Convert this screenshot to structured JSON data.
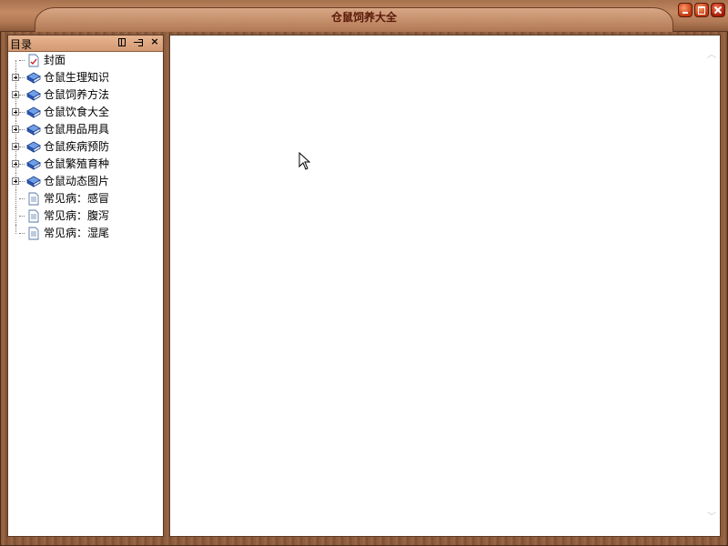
{
  "window": {
    "title": "仓鼠饲养大全",
    "buttons": {
      "minimize": "minimize-icon",
      "maximize": "maximize-icon",
      "close": "close-icon"
    }
  },
  "sidebar": {
    "title": "目录",
    "header_icons": [
      "split-view-icon",
      "pin-icon",
      "close-icon"
    ],
    "items": [
      {
        "label": "封面",
        "icon": "document-check-icon",
        "expandable": false
      },
      {
        "label": "仓鼠生理知识",
        "icon": "book-icon",
        "expandable": true
      },
      {
        "label": "仓鼠饲养方法",
        "icon": "book-icon",
        "expandable": true
      },
      {
        "label": "仓鼠饮食大全",
        "icon": "book-icon",
        "expandable": true
      },
      {
        "label": "仓鼠用品用具",
        "icon": "book-icon",
        "expandable": true
      },
      {
        "label": "仓鼠疾病预防",
        "icon": "book-icon",
        "expandable": true
      },
      {
        "label": "仓鼠繁殖育种",
        "icon": "book-icon",
        "expandable": true
      },
      {
        "label": "仓鼠动态图片",
        "icon": "book-icon",
        "expandable": true
      },
      {
        "label": "常见病：感冒",
        "icon": "document-icon",
        "expandable": false
      },
      {
        "label": "常见病：腹泻",
        "icon": "document-icon",
        "expandable": false
      },
      {
        "label": "常见病：湿尾",
        "icon": "document-icon",
        "expandable": false
      }
    ]
  },
  "colors": {
    "frame": "#8b5a3c",
    "title_text": "#5a1a0a",
    "panel_header": "#d49a73"
  }
}
